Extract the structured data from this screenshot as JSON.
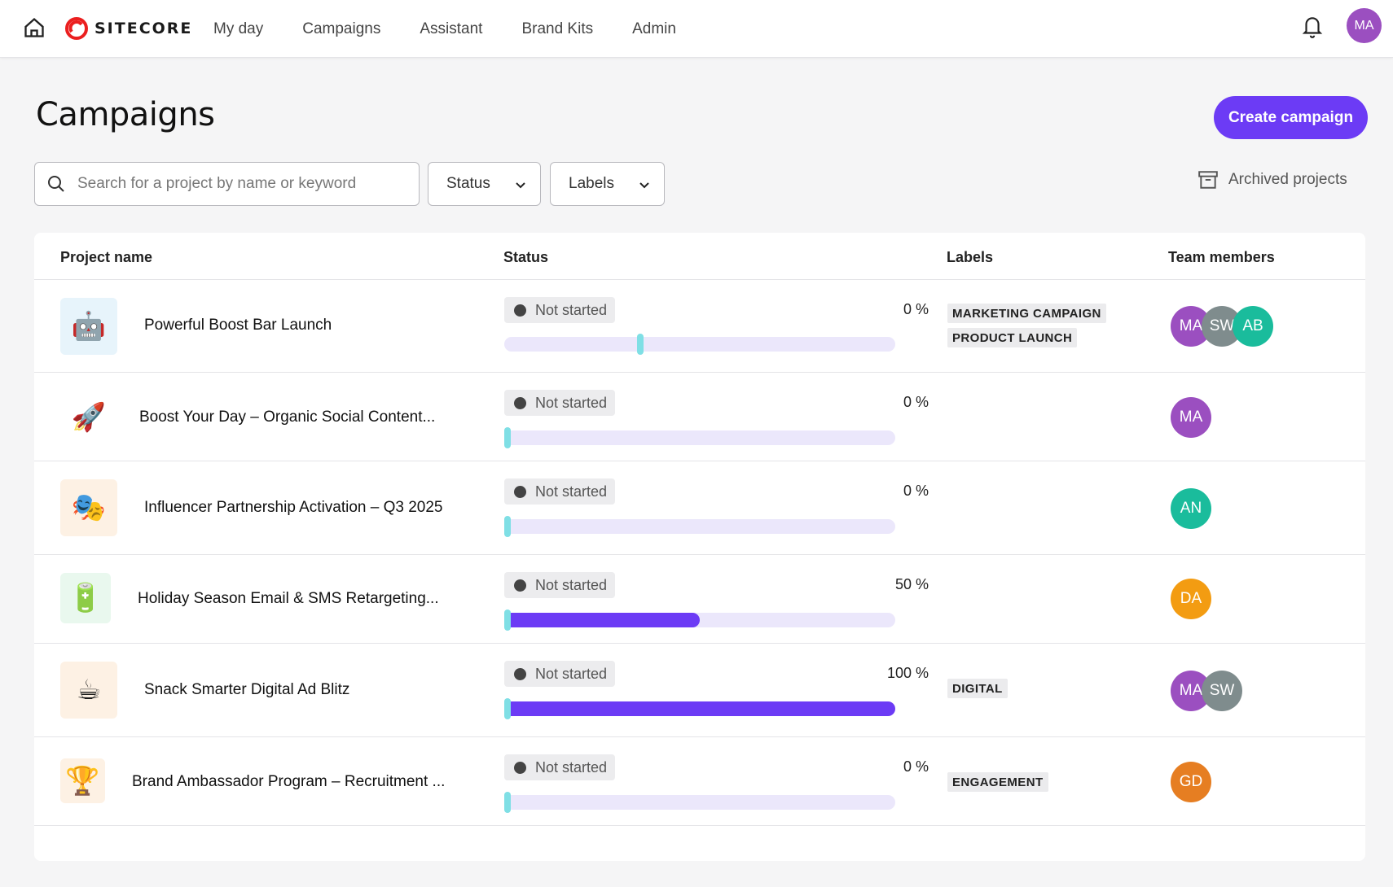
{
  "nav": {
    "brand": "SITECORE",
    "items": [
      "My day",
      "Campaigns",
      "Assistant",
      "Brand Kits",
      "Admin"
    ],
    "user_initials": "MA"
  },
  "header": {
    "title": "Campaigns",
    "create_label": "Create campaign"
  },
  "filters": {
    "search_placeholder": "Search for a project by name or keyword",
    "status_label": "Status",
    "labels_label": "Labels",
    "archived_label": "Archived projects"
  },
  "table": {
    "columns": [
      "Project name",
      "Status",
      "Labels",
      "Team members"
    ],
    "rows": [
      {
        "name": "Powerful Boost Bar Launch",
        "icon": "🤖",
        "status": "Not started",
        "progress_label": "0 %",
        "progress": 0,
        "labels": [
          "MARKETING CAMPAIGN",
          "PRODUCT LAUNCH"
        ],
        "members": [
          "MA",
          "SW",
          "AB"
        ]
      },
      {
        "name": "Boost Your Day – Organic Social Content...",
        "icon": "🚀",
        "status": "Not started",
        "progress_label": "0 %",
        "progress": 0,
        "labels": [],
        "members": [
          "MA"
        ]
      },
      {
        "name": "Influencer Partnership Activation – Q3 2025",
        "icon": "🎭",
        "status": "Not started",
        "progress_label": "0 %",
        "progress": 0,
        "labels": [],
        "members": [
          "AN"
        ]
      },
      {
        "name": "Holiday Season Email & SMS Retargeting...",
        "icon": "🔋",
        "status": "Not started",
        "progress_label": "50 %",
        "progress": 50,
        "labels": [],
        "members": [
          "DA"
        ]
      },
      {
        "name": "Snack Smarter Digital Ad Blitz",
        "icon": "☕",
        "status": "Not started",
        "progress_label": "100 %",
        "progress": 100,
        "labels": [
          "DIGITAL"
        ],
        "members": [
          "MA",
          "SW"
        ]
      },
      {
        "name": "Brand Ambassador Program – Recruitment ...",
        "icon": "🏆",
        "status": "Not started",
        "progress_label": "0 %",
        "progress": 0,
        "labels": [
          "ENGAGEMENT"
        ],
        "members": [
          "GD"
        ]
      }
    ]
  },
  "colors": {
    "accent": "#6c3bf5",
    "avatar_MA": "#9b4fc0",
    "avatar_SW": "#7f8c8d",
    "avatar_AB": "#1abc9c",
    "avatar_AN": "#1abc9c",
    "avatar_DA": "#f39c12",
    "avatar_GD": "#e67e22"
  }
}
